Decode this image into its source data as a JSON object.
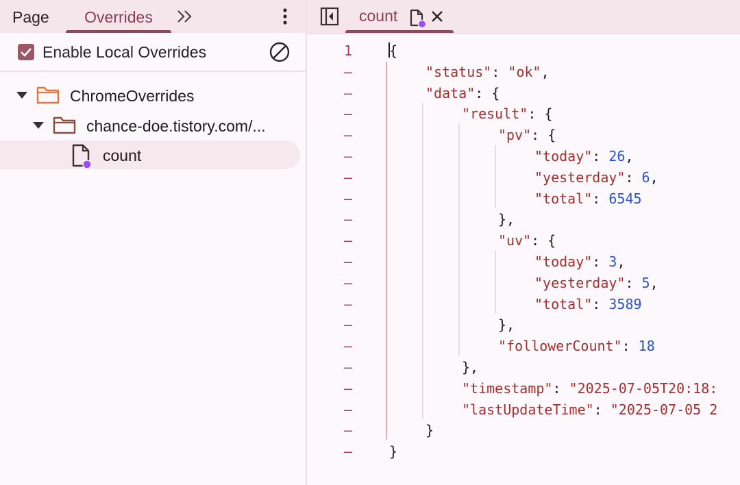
{
  "left_panel": {
    "tabs": {
      "page": "Page",
      "overrides": "Overrides"
    },
    "enable_local_overrides": {
      "label": "Enable Local Overrides",
      "checked": true
    },
    "tree": {
      "root_folder": "ChromeOverrides",
      "site_folder": "chance-doe.tistory.com/...",
      "file": "count"
    }
  },
  "editor": {
    "tab_label": "count",
    "line_number": "1",
    "collapsed_marker": "–",
    "lines": [
      [
        "{"
      ],
      [
        "\"status\"",
        ": ",
        "\"ok\"",
        ","
      ],
      [
        "\"data\"",
        ": {"
      ],
      [
        "\"result\"",
        ": {"
      ],
      [
        "\"pv\"",
        ": {"
      ],
      [
        "\"today\"",
        ": ",
        "26",
        ","
      ],
      [
        "\"yesterday\"",
        ": ",
        "6",
        ","
      ],
      [
        "\"total\"",
        ": ",
        "6545"
      ],
      [
        "},"
      ],
      [
        "\"uv\"",
        ": {"
      ],
      [
        "\"today\"",
        ": ",
        "3",
        ","
      ],
      [
        "\"yesterday\"",
        ": ",
        "5",
        ","
      ],
      [
        "\"total\"",
        ": ",
        "3589"
      ],
      [
        "},"
      ],
      [
        "\"followerCount\"",
        ": ",
        "18"
      ],
      [
        "},"
      ],
      [
        "\"timestamp\"",
        ": ",
        "\"2025-07-05T20:18:"
      ],
      [
        "\"lastUpdateTime\"",
        ": ",
        "\"2025-07-05 2"
      ],
      [
        "}"
      ],
      [
        "}"
      ]
    ]
  },
  "colors": {
    "accent": "#8c3d55",
    "string": "#a3302e",
    "number": "#2a54c9",
    "tabbar": "#f4e6ea"
  },
  "icons": [
    "chevron-double-right-icon",
    "more-vert-icon",
    "block-icon",
    "folder-icon",
    "file-icon",
    "sidebar-toggle-icon",
    "close-icon"
  ]
}
